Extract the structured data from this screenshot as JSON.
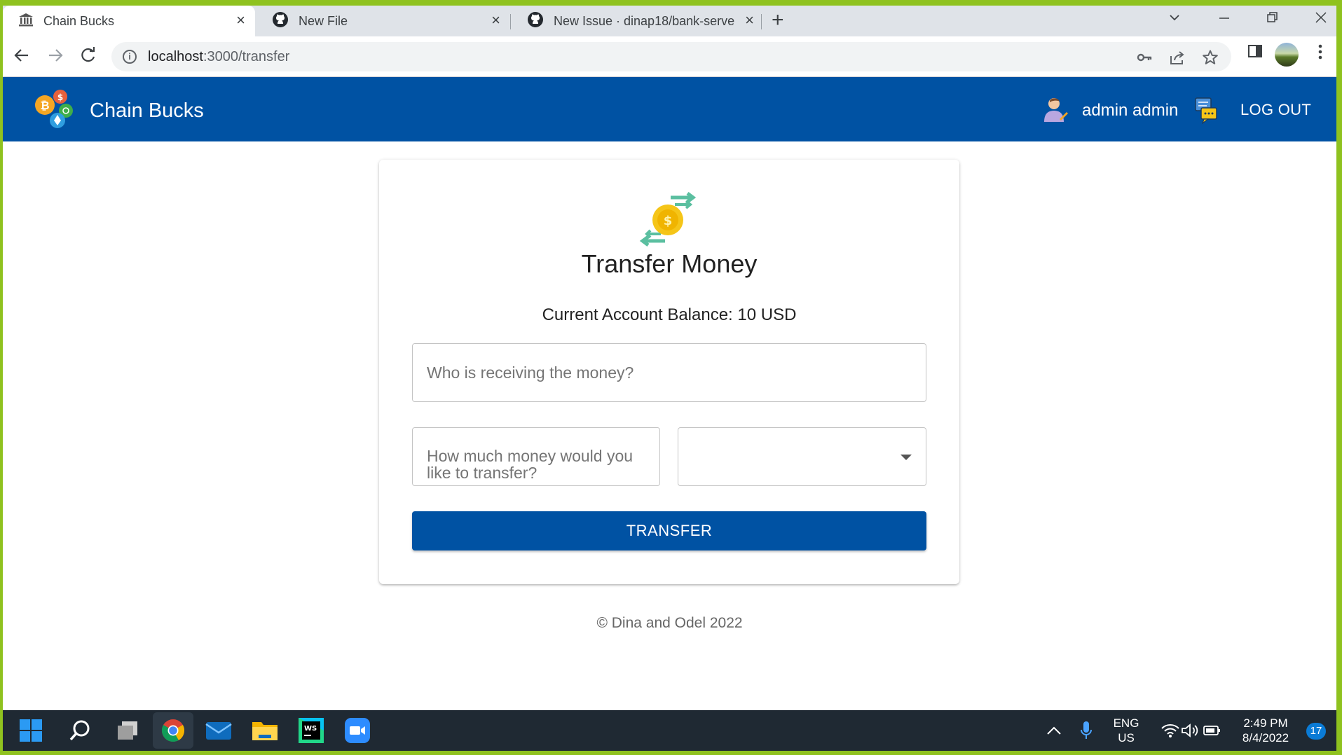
{
  "browser": {
    "tabs": [
      {
        "title": "Chain Bucks",
        "active": true
      },
      {
        "title": "New File",
        "active": false
      },
      {
        "title": "New Issue · dinap18/bank-server",
        "active": false
      }
    ],
    "url_host": "localhost",
    "url_rest": ":3000/transfer"
  },
  "app": {
    "title": "Chain Bucks",
    "user_name": "admin admin",
    "logout_label": "LOG OUT"
  },
  "transfer": {
    "title": "Transfer Money",
    "balance_text": "Current Account Balance: 10 USD",
    "recipient_placeholder": "Who is receiving the money?",
    "amount_placeholder": "How much money would you like to transfer?",
    "currency_value": "",
    "submit_label": "TRANSFER"
  },
  "footer": {
    "text": "© Dina and Odel 2022"
  },
  "taskbar": {
    "lang_top": "ENG",
    "lang_bottom": "US",
    "time": "2:49 PM",
    "date": "8/4/2022",
    "notifications": "17"
  },
  "colors": {
    "brand": "#0052a3",
    "taskbar": "#1f2933",
    "desktop_border": "#8fc21f"
  }
}
